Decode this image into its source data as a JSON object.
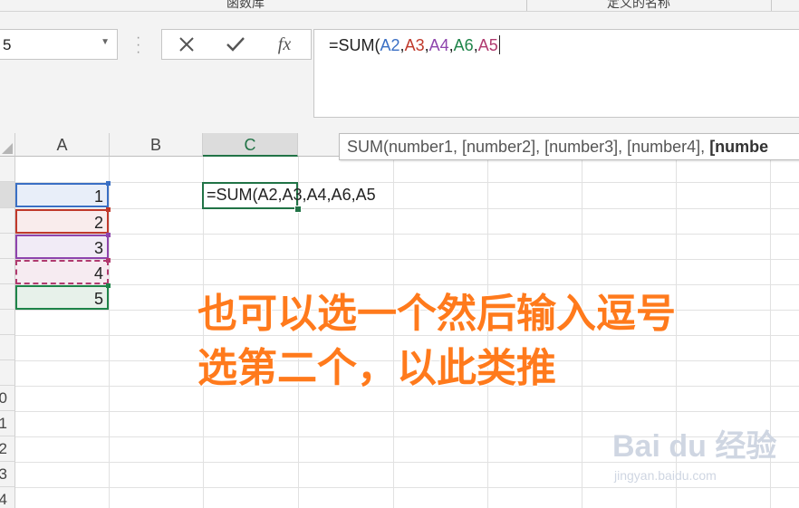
{
  "ribbon": {
    "group1": "函数库",
    "group2": "定义的名称"
  },
  "formula_bar": {
    "name_box_value": "5",
    "cancel_icon": "close-icon",
    "enter_icon": "check-icon",
    "fx_label": "fx",
    "formula_parts": [
      {
        "text": "=SUM(",
        "color": "#222222"
      },
      {
        "text": "A2",
        "color": "#3a6fc4"
      },
      {
        "text": ",",
        "color": "#222222"
      },
      {
        "text": "A3",
        "color": "#c0392b"
      },
      {
        "text": ",",
        "color": "#222222"
      },
      {
        "text": "A4",
        "color": "#8e44ad"
      },
      {
        "text": ",",
        "color": "#222222"
      },
      {
        "text": "A6",
        "color": "#1e8449"
      },
      {
        "text": ",",
        "color": "#222222"
      },
      {
        "text": "A5",
        "color": "#b03a6f"
      }
    ]
  },
  "columns": [
    "A",
    "B",
    "C"
  ],
  "row_labels": [
    "0",
    "1",
    "2",
    "3",
    "4"
  ],
  "cells_A": [
    "1",
    "2",
    "3",
    "4",
    "5"
  ],
  "range_colors": [
    "#3a6fc4",
    "#c0392b",
    "#8e44ad",
    "#b03a6f",
    "#1e8449"
  ],
  "range_fills": [
    "#e8eef9",
    "#f9ecec",
    "#f1ebf6",
    "#f6ebf1",
    "#e7f1ea"
  ],
  "active_cell_text": "=SUM(A2,A3,A4,A6,A5",
  "tooltip": {
    "text": "SUM(number1, [number2], [number3], [number4], ",
    "bold": "[numbe"
  },
  "annotation": {
    "line1": "也可以选一个然后输入逗号",
    "line2": "选第二个，以此类推"
  },
  "watermark": {
    "main": "Bai du 经验",
    "sub": "jingyan.baidu.com"
  },
  "accent_color": "#217346"
}
